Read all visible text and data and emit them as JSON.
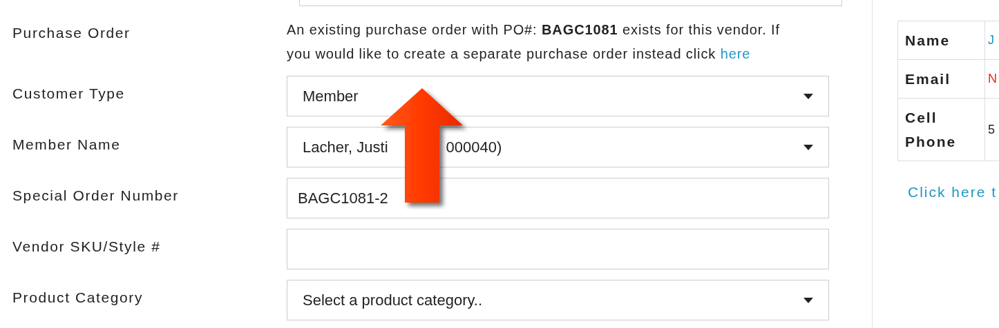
{
  "purchase_order": {
    "label": "Purchase Order",
    "message": "An existing purchase order with PO#: **BAGC1081** exists for this vendor. If you would like to create a separate purchase order instead click",
    "link": "here"
  },
  "fields": [
    {
      "label": "Customer Type",
      "kind": "select",
      "value": [
        "Member"
      ]
    },
    {
      "label": "Member Name",
      "kind": "select",
      "value": [
        "Lacher, Justi",
        "000040)"
      ]
    },
    {
      "label": "Special Order Number",
      "kind": "text",
      "value": [
        "BAGC1081-2"
      ]
    },
    {
      "label": "Vendor SKU/Style #",
      "kind": "text"
    },
    {
      "label": "Product Category",
      "kind": "select",
      "value": [
        "Select a product category.."
      ]
    }
  ],
  "contact_table": [
    {
      "label": "Name",
      "value": "J",
      "kind": "link"
    },
    {
      "label": "Email",
      "value": "N",
      "kind": "warning"
    },
    {
      "label": "Cell Phone",
      "value": "5",
      "kind": "text"
    }
  ],
  "contact_link": "Click here t"
}
